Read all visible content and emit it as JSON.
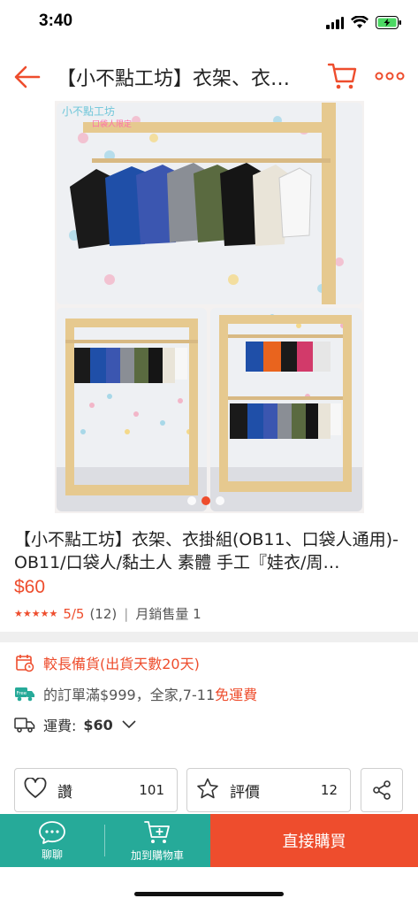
{
  "status_bar": {
    "time": "3:40"
  },
  "header": {
    "title": "【小不點工坊】衣架、衣…",
    "icons": [
      "back-arrow-icon",
      "cart-icon",
      "more-icon"
    ]
  },
  "gallery": {
    "watermark": "小不點工坊",
    "watermark_sub": "口袋人限定",
    "image_count": 3,
    "active_index": 1
  },
  "product": {
    "title": "【小不點工坊】衣架、衣掛組(OB11、口袋人通用)- OB11/口袋人/黏土人 素體 手工『娃衣/周…",
    "price": "$60",
    "stars": "★★★★★",
    "rating": "5/5",
    "rating_count": "(12)",
    "monthly_sales": "月銷售量 1"
  },
  "shipping": {
    "preparation": "較長備貨(出貨天數20天)",
    "free_shipping_prefix": "的訂單滿$999，全家,7-11",
    "free_shipping_suffix": "免運費",
    "fee_label": "運費:",
    "fee_value": "$60"
  },
  "actions": {
    "like_label": "讚",
    "like_count": "101",
    "review_label": "評價",
    "review_count": "12"
  },
  "bottom_bar": {
    "chat_label": "聊聊",
    "add_cart_label": "加到購物車",
    "buy_label": "直接購買"
  },
  "colors": {
    "brand": "#ee4d2d",
    "teal": "#26aa99"
  }
}
